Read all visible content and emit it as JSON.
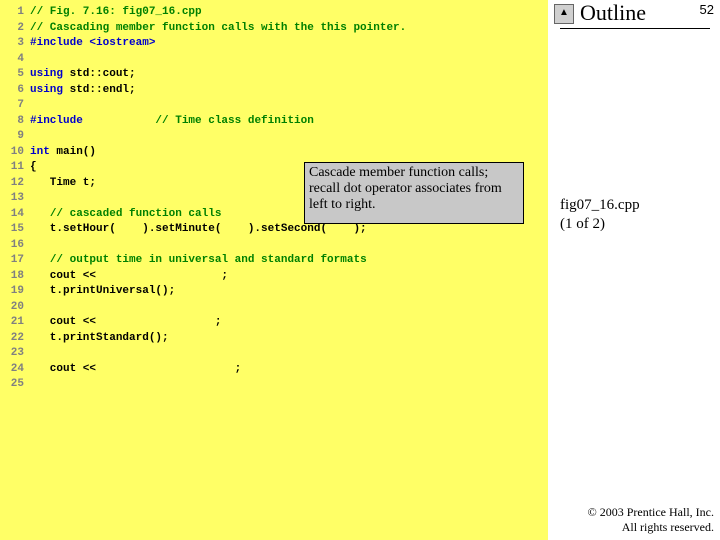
{
  "pageNumber": "52",
  "outlineTitle": "Outline",
  "arrow": "▲",
  "figLabel1": "fig07_16.cpp",
  "figLabel2": "(1 of 2)",
  "callout": "Cascade member function calls; recall dot operator associates from left to right.",
  "copyright1": "© 2003 Prentice Hall, Inc.",
  "copyright2": "All rights reserved.",
  "code": [
    {
      "n": "1",
      "segs": [
        {
          "c": "cmt",
          "t": "// Fig. 7.16: fig07_16.cpp"
        }
      ]
    },
    {
      "n": "2",
      "segs": [
        {
          "c": "cmt",
          "t": "// Cascading member function calls with the this pointer."
        }
      ]
    },
    {
      "n": "3",
      "segs": [
        {
          "c": "kw",
          "t": "#include "
        },
        {
          "c": "kw",
          "t": "<iostream>"
        }
      ]
    },
    {
      "n": "4",
      "segs": []
    },
    {
      "n": "5",
      "segs": [
        {
          "c": "kw",
          "t": "using "
        },
        {
          "c": "pln",
          "t": "std::cout;"
        }
      ]
    },
    {
      "n": "6",
      "segs": [
        {
          "c": "kw",
          "t": "using "
        },
        {
          "c": "pln",
          "t": "std::endl;"
        }
      ]
    },
    {
      "n": "7",
      "segs": []
    },
    {
      "n": "8",
      "segs": [
        {
          "c": "kw",
          "t": "#include           "
        },
        {
          "c": "cmt",
          "t": "// Time class definition"
        }
      ]
    },
    {
      "n": "9",
      "segs": []
    },
    {
      "n": "10",
      "segs": [
        {
          "c": "kw",
          "t": "int "
        },
        {
          "c": "pln",
          "t": "main()"
        }
      ]
    },
    {
      "n": "11",
      "segs": [
        {
          "c": "pln",
          "t": "{"
        }
      ]
    },
    {
      "n": "12",
      "segs": [
        {
          "c": "pln",
          "t": "   Time t;"
        }
      ]
    },
    {
      "n": "13",
      "segs": []
    },
    {
      "n": "14",
      "segs": [
        {
          "c": "pln",
          "t": "   "
        },
        {
          "c": "cmt",
          "t": "// cascaded function calls"
        }
      ]
    },
    {
      "n": "15",
      "segs": [
        {
          "c": "pln",
          "t": "   t.setHour(    ).setMinute(    ).setSecond(    );"
        }
      ]
    },
    {
      "n": "16",
      "segs": []
    },
    {
      "n": "17",
      "segs": [
        {
          "c": "pln",
          "t": "   "
        },
        {
          "c": "cmt",
          "t": "// output time in universal and standard formats"
        }
      ]
    },
    {
      "n": "18",
      "segs": [
        {
          "c": "pln",
          "t": "   cout <<                   ;"
        }
      ]
    },
    {
      "n": "19",
      "segs": [
        {
          "c": "pln",
          "t": "   t.printUniversal();"
        }
      ]
    },
    {
      "n": "20",
      "segs": []
    },
    {
      "n": "21",
      "segs": [
        {
          "c": "pln",
          "t": "   cout <<                  ;"
        }
      ]
    },
    {
      "n": "22",
      "segs": [
        {
          "c": "pln",
          "t": "   t.printStandard();"
        }
      ]
    },
    {
      "n": "23",
      "segs": []
    },
    {
      "n": "24",
      "segs": [
        {
          "c": "pln",
          "t": "   cout <<                     ;"
        }
      ]
    },
    {
      "n": "25",
      "segs": []
    }
  ]
}
